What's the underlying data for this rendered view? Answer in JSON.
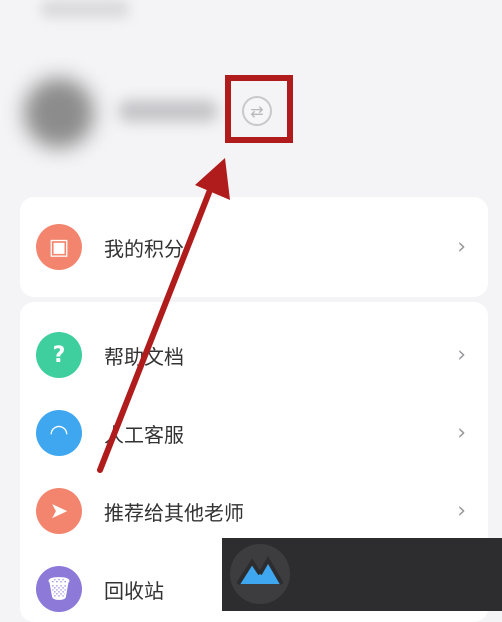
{
  "menu": {
    "points": {
      "label": "我的积分",
      "icon": "gift-icon"
    },
    "help": {
      "label": "帮助文档",
      "icon": "question-chat-icon"
    },
    "service": {
      "label": "人工客服",
      "icon": "headset-icon"
    },
    "recommend": {
      "label": "推荐给其他老师",
      "icon": "paper-plane-icon"
    },
    "recycle": {
      "label": "回收站",
      "icon": "trash-icon"
    }
  },
  "colors": {
    "points": "#f3856e",
    "help": "#3fcf9e",
    "service": "#3fa7f0",
    "recommend": "#f3856e",
    "recycle": "#8d7ad8",
    "annotation": "#b01c1c"
  }
}
